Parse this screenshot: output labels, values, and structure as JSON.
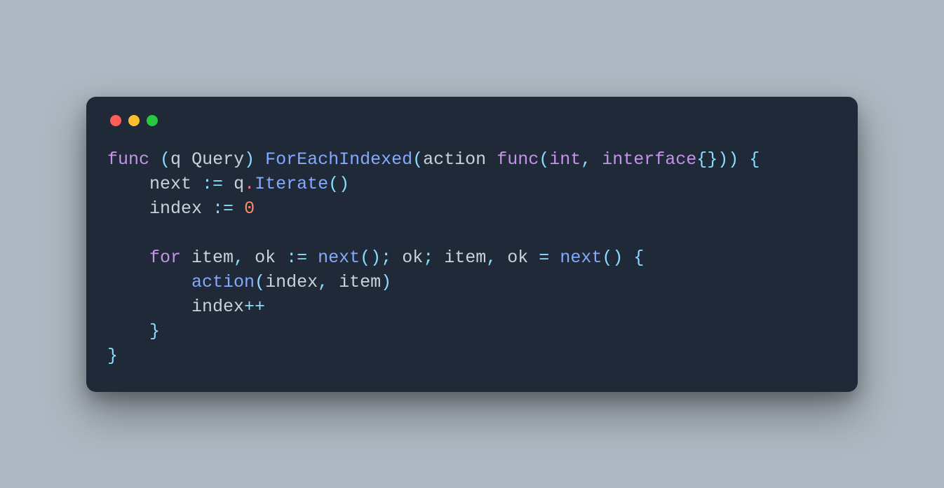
{
  "colors": {
    "bg": "#aeb8c2",
    "window": "#1f2937",
    "dots": {
      "red": "#ff5f56",
      "yellow": "#ffbd2e",
      "green": "#27c93f"
    },
    "syntax": {
      "keyword": "#c792ea",
      "function": "#82aaff",
      "identifier": "#c9d1d9",
      "type": "#8be9fd",
      "number": "#f78c6c",
      "operator": "#89ddff",
      "punct": "#89ddff",
      "dot": "#f07178"
    }
  },
  "code": {
    "l1": {
      "kw_func": "func",
      "p_open1": " (",
      "recv_q": "q",
      "sp1": " ",
      "ty_query": "Query",
      "p_close1": ") ",
      "fn_name": "ForEachIndexed",
      "p_open2": "(",
      "param": "action",
      "sp2": " ",
      "kw_func2": "func",
      "p_open3": "(",
      "ty_int": "int",
      "comma": ", ",
      "kw_iface": "interface",
      "braces_empty": "{}",
      "p_close3_2": "))",
      "sp3": " ",
      "brace_open": "{"
    },
    "l2": {
      "indent": "    ",
      "next": "next",
      "sp1": " ",
      "op": ":=",
      "sp2": " ",
      "q": "q",
      "dot": ".",
      "fn": "Iterate",
      "parens": "()"
    },
    "l3": {
      "indent": "    ",
      "index": "index",
      "sp1": " ",
      "op": ":=",
      "sp2": " ",
      "zero": "0"
    },
    "l5": {
      "indent": "    ",
      "kw_for": "for",
      "sp1": " ",
      "item1": "item",
      "comma1": ", ",
      "ok1": "ok",
      "sp2": " ",
      "op1": ":=",
      "sp3": " ",
      "next1": "next",
      "call1": "()",
      "semi1": "; ",
      "ok2": "ok",
      "semi2": "; ",
      "item2": "item",
      "comma2": ", ",
      "ok3": "ok",
      "sp4": " ",
      "op2": "=",
      "sp5": " ",
      "next2": "next",
      "call2": "()",
      "sp6": " ",
      "brace": "{"
    },
    "l6": {
      "indent": "        ",
      "fn": "action",
      "open": "(",
      "index": "index",
      "comma": ", ",
      "item": "item",
      "close": ")"
    },
    "l7": {
      "indent": "        ",
      "index": "index",
      "op": "++"
    },
    "l8": {
      "indent": "    ",
      "brace": "}"
    },
    "l9": {
      "brace": "}"
    }
  }
}
